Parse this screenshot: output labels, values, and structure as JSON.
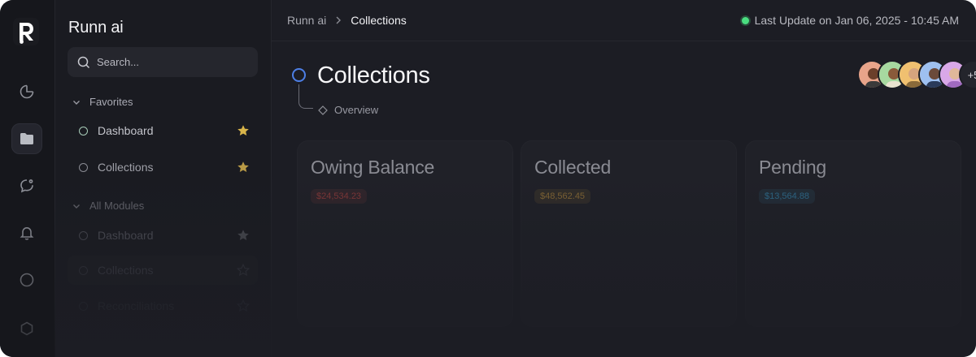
{
  "app": {
    "logo": "R"
  },
  "rail": {
    "icons": [
      "pie-chart-icon",
      "folder-icon",
      "chat-icon",
      "bell-icon",
      "info-icon",
      "settings-icon"
    ],
    "active": "folder-icon"
  },
  "sidebar": {
    "title": "Runn ai",
    "search_placeholder": "Search...",
    "favorites": {
      "label": "Favorites",
      "items": [
        {
          "label": "Dashboard",
          "starred": true
        },
        {
          "label": "Collections",
          "starred": true
        }
      ]
    },
    "modules": {
      "label": "All Modules",
      "items": [
        {
          "label": "Dashboard",
          "starred": true
        },
        {
          "label": "Collections",
          "starred": false
        },
        {
          "label": "Reconciliations",
          "starred": false
        }
      ]
    }
  },
  "topbar": {
    "breadcrumb": [
      "Runn ai",
      "Collections"
    ],
    "status": "Last Update on Jan 06, 2025 - 10:45 AM"
  },
  "page": {
    "title": "Collections",
    "sub_link": "Overview",
    "avatars_more": "+5"
  },
  "cards": [
    {
      "title": "Owing Balance",
      "value": "$24,534.23",
      "color": "#b94a4a"
    },
    {
      "title": "Collected",
      "value": "$48,562.45",
      "color": "#b88a3a"
    },
    {
      "title": "Pending",
      "value": "$13,564.88",
      "color": "#3a8db8"
    }
  ],
  "colors": {
    "accent": "#4d7fe6",
    "star": "#d9b54a",
    "online": "#4ade80"
  }
}
